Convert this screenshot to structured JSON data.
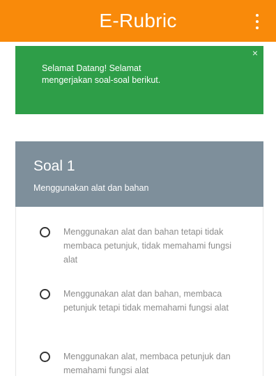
{
  "appbar": {
    "title": "E-Rubric",
    "menu_icon": "more-vert-icon"
  },
  "alert": {
    "message": "Selamat Datang! Selamat mengerjakan soal-soal berikut.",
    "close_label": "×",
    "color": "#2e9e48"
  },
  "question": {
    "title": "Soal 1",
    "subtitle": "Menggunakan alat dan bahan",
    "header_color": "#7e8f9b",
    "options": [
      "Menggunakan alat dan bahan tetapi tidak membaca petunjuk, tidak memahami fungsi alat",
      "Menggunakan alat dan bahan, membaca petunjuk tetapi tidak memahami fungsi alat",
      "Menggunakan alat, membaca petunjuk dan memahami fungsi alat"
    ]
  },
  "colors": {
    "appbar": "#f98a0a"
  }
}
